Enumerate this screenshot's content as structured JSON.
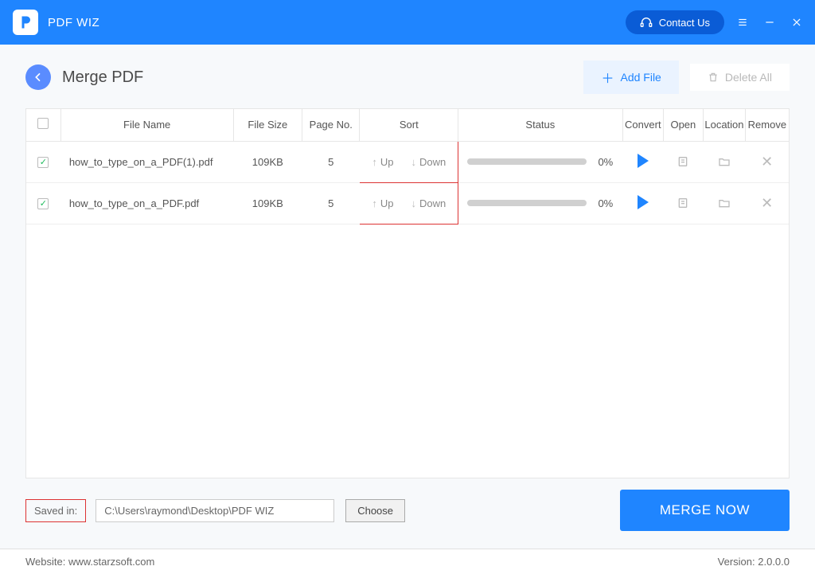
{
  "titlebar": {
    "app_name": "PDF WIZ",
    "contact_label": "Contact Us"
  },
  "page": {
    "title": "Merge PDF",
    "add_file_label": "Add File",
    "delete_all_label": "Delete All"
  },
  "table": {
    "headers": {
      "file_name": "File Name",
      "file_size": "File Size",
      "page_no": "Page No.",
      "sort": "Sort",
      "status": "Status",
      "convert": "Convert",
      "open": "Open",
      "location": "Location",
      "remove": "Remove"
    },
    "sort_up_label": "Up",
    "sort_down_label": "Down",
    "rows": [
      {
        "checked": true,
        "file_name": "how_to_type_on_a_PDF(1).pdf",
        "file_size": "109KB",
        "page_no": "5",
        "progress_pct": "0%"
      },
      {
        "checked": true,
        "file_name": "how_to_type_on_a_PDF.pdf",
        "file_size": "109KB",
        "page_no": "5",
        "progress_pct": "0%"
      }
    ]
  },
  "bottom": {
    "saved_in_label": "Saved in:",
    "path_value": "C:\\Users\\raymond\\Desktop\\PDF WIZ",
    "choose_label": "Choose",
    "merge_label": "MERGE NOW"
  },
  "footer": {
    "website_label": "Website: www.starzsoft.com",
    "version_label": "Version: 2.0.0.0"
  }
}
